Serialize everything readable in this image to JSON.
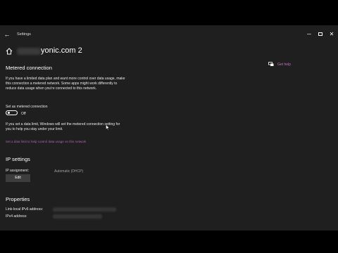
{
  "window": {
    "app_title": "Settings",
    "controls": {
      "minimize": "─",
      "maximize": "",
      "close": "✕"
    }
  },
  "header": {
    "network_name_suffix": "yonic.com  2"
  },
  "help": {
    "label": "Get help",
    "icon": "chat-help-icon"
  },
  "metered": {
    "title": "Metered connection",
    "description": "If you have a limited data plan and want more control over data usage, make this connection a metered network. Some apps might work differently to reduce data usage when you're connected to this network.",
    "toggle_label": "Set as metered connection",
    "toggle_state": "Off",
    "toggle_on": false,
    "limit_note": "If you set a data limit, Windows will set the metered connection setting for you to help you stay under your limit.",
    "limit_link": "Set a data limit to help control data usage on this network"
  },
  "ip": {
    "title": "IP settings",
    "assignment_label": "IP assignment:",
    "assignment_value": "Automatic (DHCP)",
    "edit_label": "Edit"
  },
  "properties": {
    "title": "Properties",
    "ipv6_label": "Link-local IPv6 address:",
    "ipv4_label": "IPv4 address:"
  },
  "colors": {
    "background": "#1f1f1f",
    "accent_link": "#c070c0"
  }
}
